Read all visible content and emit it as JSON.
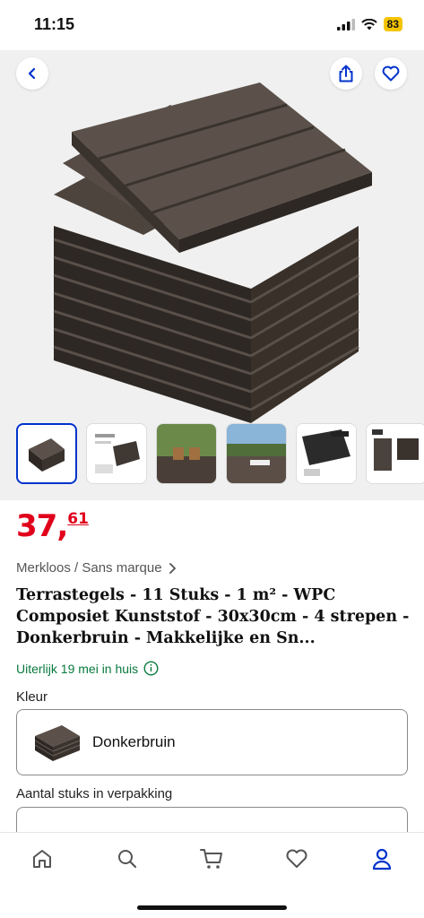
{
  "status": {
    "time": "11:15",
    "battery": "83"
  },
  "icons": {
    "back": "chevron-left-icon",
    "share": "share-icon",
    "favorite": "heart-icon",
    "brand_chevron": "chevron-right-icon",
    "info": "info-icon",
    "tabs": [
      "home-icon",
      "search-icon",
      "cart-icon",
      "heart-icon",
      "user-icon"
    ]
  },
  "product": {
    "price_int": "37,",
    "price_dec": "61",
    "brand": "Merkloos / Sans marque",
    "title": "Terrastegels - 11 Stuks - 1 m² - WPC Composiet Kunststof - 30x30cm - 4 strepen - Donkerbruin - Makkelijke en Sn...",
    "delivery": "Uiterlijk 19 mei in huis"
  },
  "options": {
    "color_label": "Kleur",
    "color_value": "Donkerbruin",
    "qty_label": "Aantal stuks in verpakking"
  },
  "colors": {
    "price": "#e0001b",
    "accent": "#0033cc",
    "delivery": "#0a7a3e",
    "tile": "#4a423d"
  }
}
